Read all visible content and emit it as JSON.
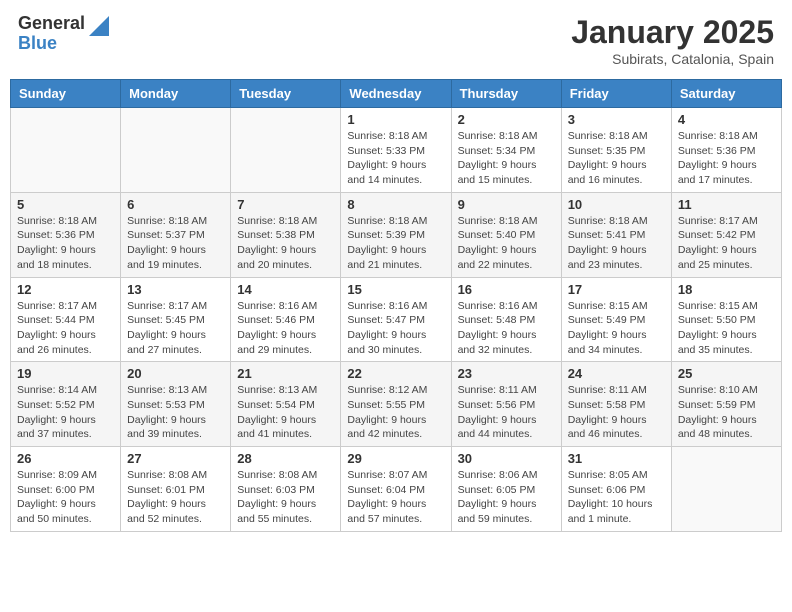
{
  "header": {
    "logo_general": "General",
    "logo_blue": "Blue",
    "month_title": "January 2025",
    "location": "Subirats, Catalonia, Spain"
  },
  "weekdays": [
    "Sunday",
    "Monday",
    "Tuesday",
    "Wednesday",
    "Thursday",
    "Friday",
    "Saturday"
  ],
  "weeks": [
    [
      {
        "day": "",
        "info": ""
      },
      {
        "day": "",
        "info": ""
      },
      {
        "day": "",
        "info": ""
      },
      {
        "day": "1",
        "info": "Sunrise: 8:18 AM\nSunset: 5:33 PM\nDaylight: 9 hours\nand 14 minutes."
      },
      {
        "day": "2",
        "info": "Sunrise: 8:18 AM\nSunset: 5:34 PM\nDaylight: 9 hours\nand 15 minutes."
      },
      {
        "day": "3",
        "info": "Sunrise: 8:18 AM\nSunset: 5:35 PM\nDaylight: 9 hours\nand 16 minutes."
      },
      {
        "day": "4",
        "info": "Sunrise: 8:18 AM\nSunset: 5:36 PM\nDaylight: 9 hours\nand 17 minutes."
      }
    ],
    [
      {
        "day": "5",
        "info": "Sunrise: 8:18 AM\nSunset: 5:36 PM\nDaylight: 9 hours\nand 18 minutes."
      },
      {
        "day": "6",
        "info": "Sunrise: 8:18 AM\nSunset: 5:37 PM\nDaylight: 9 hours\nand 19 minutes."
      },
      {
        "day": "7",
        "info": "Sunrise: 8:18 AM\nSunset: 5:38 PM\nDaylight: 9 hours\nand 20 minutes."
      },
      {
        "day": "8",
        "info": "Sunrise: 8:18 AM\nSunset: 5:39 PM\nDaylight: 9 hours\nand 21 minutes."
      },
      {
        "day": "9",
        "info": "Sunrise: 8:18 AM\nSunset: 5:40 PM\nDaylight: 9 hours\nand 22 minutes."
      },
      {
        "day": "10",
        "info": "Sunrise: 8:18 AM\nSunset: 5:41 PM\nDaylight: 9 hours\nand 23 minutes."
      },
      {
        "day": "11",
        "info": "Sunrise: 8:17 AM\nSunset: 5:42 PM\nDaylight: 9 hours\nand 25 minutes."
      }
    ],
    [
      {
        "day": "12",
        "info": "Sunrise: 8:17 AM\nSunset: 5:44 PM\nDaylight: 9 hours\nand 26 minutes."
      },
      {
        "day": "13",
        "info": "Sunrise: 8:17 AM\nSunset: 5:45 PM\nDaylight: 9 hours\nand 27 minutes."
      },
      {
        "day": "14",
        "info": "Sunrise: 8:16 AM\nSunset: 5:46 PM\nDaylight: 9 hours\nand 29 minutes."
      },
      {
        "day": "15",
        "info": "Sunrise: 8:16 AM\nSunset: 5:47 PM\nDaylight: 9 hours\nand 30 minutes."
      },
      {
        "day": "16",
        "info": "Sunrise: 8:16 AM\nSunset: 5:48 PM\nDaylight: 9 hours\nand 32 minutes."
      },
      {
        "day": "17",
        "info": "Sunrise: 8:15 AM\nSunset: 5:49 PM\nDaylight: 9 hours\nand 34 minutes."
      },
      {
        "day": "18",
        "info": "Sunrise: 8:15 AM\nSunset: 5:50 PM\nDaylight: 9 hours\nand 35 minutes."
      }
    ],
    [
      {
        "day": "19",
        "info": "Sunrise: 8:14 AM\nSunset: 5:52 PM\nDaylight: 9 hours\nand 37 minutes."
      },
      {
        "day": "20",
        "info": "Sunrise: 8:13 AM\nSunset: 5:53 PM\nDaylight: 9 hours\nand 39 minutes."
      },
      {
        "day": "21",
        "info": "Sunrise: 8:13 AM\nSunset: 5:54 PM\nDaylight: 9 hours\nand 41 minutes."
      },
      {
        "day": "22",
        "info": "Sunrise: 8:12 AM\nSunset: 5:55 PM\nDaylight: 9 hours\nand 42 minutes."
      },
      {
        "day": "23",
        "info": "Sunrise: 8:11 AM\nSunset: 5:56 PM\nDaylight: 9 hours\nand 44 minutes."
      },
      {
        "day": "24",
        "info": "Sunrise: 8:11 AM\nSunset: 5:58 PM\nDaylight: 9 hours\nand 46 minutes."
      },
      {
        "day": "25",
        "info": "Sunrise: 8:10 AM\nSunset: 5:59 PM\nDaylight: 9 hours\nand 48 minutes."
      }
    ],
    [
      {
        "day": "26",
        "info": "Sunrise: 8:09 AM\nSunset: 6:00 PM\nDaylight: 9 hours\nand 50 minutes."
      },
      {
        "day": "27",
        "info": "Sunrise: 8:08 AM\nSunset: 6:01 PM\nDaylight: 9 hours\nand 52 minutes."
      },
      {
        "day": "28",
        "info": "Sunrise: 8:08 AM\nSunset: 6:03 PM\nDaylight: 9 hours\nand 55 minutes."
      },
      {
        "day": "29",
        "info": "Sunrise: 8:07 AM\nSunset: 6:04 PM\nDaylight: 9 hours\nand 57 minutes."
      },
      {
        "day": "30",
        "info": "Sunrise: 8:06 AM\nSunset: 6:05 PM\nDaylight: 9 hours\nand 59 minutes."
      },
      {
        "day": "31",
        "info": "Sunrise: 8:05 AM\nSunset: 6:06 PM\nDaylight: 10 hours\nand 1 minute."
      },
      {
        "day": "",
        "info": ""
      }
    ]
  ]
}
